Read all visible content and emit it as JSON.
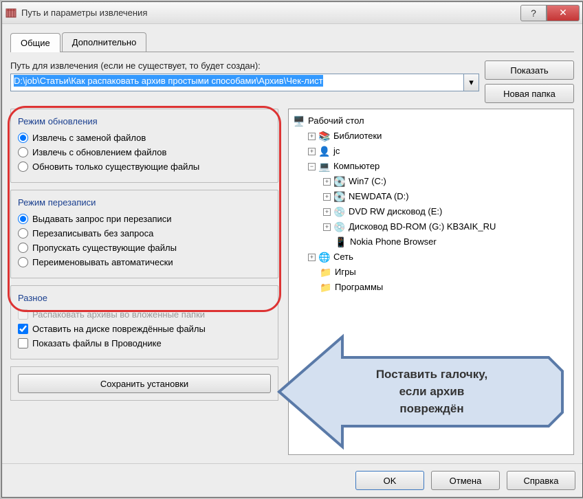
{
  "window": {
    "title": "Путь и параметры извлечения"
  },
  "tabs": {
    "general": "Общие",
    "advanced": "Дополнительно"
  },
  "path": {
    "label": "Путь для извлечения (если не существует, то будет создан):",
    "value": "D:\\job\\Статьи\\Как распаковать архив простыми способами\\Архив\\Чек-лист"
  },
  "buttons": {
    "show": "Показать",
    "new_folder": "Новая папка",
    "save": "Сохранить установки",
    "ok": "OK",
    "cancel": "Отмена",
    "help": "Справка"
  },
  "update_mode": {
    "legend": "Режим обновления",
    "opt1": "Извлечь с заменой файлов",
    "opt2": "Извлечь с обновлением файлов",
    "opt3": "Обновить только существующие файлы"
  },
  "overwrite_mode": {
    "legend": "Режим перезаписи",
    "opt1": "Выдавать запрос при перезаписи",
    "opt2": "Перезаписывать без запроса",
    "opt3": "Пропускать существующие файлы",
    "opt4": "Переименовывать автоматически"
  },
  "misc": {
    "legend": "Разное",
    "opt1": "Распаковать архивы во вложенные папки",
    "opt2": "Оставить на диске повреждённые файлы",
    "opt3": "Показать файлы в Проводнике"
  },
  "tree": {
    "desktop": "Рабочий стол",
    "libraries": "Библиотеки",
    "jc": "jc",
    "computer": "Компьютер",
    "win7": "Win7 (C:)",
    "newdata": "NEWDATA (D:)",
    "dvdrw": "DVD RW дисковод (E:)",
    "bdrom": "Дисковод BD-ROM (G:) KB3AIK_RU",
    "nokia": "Nokia Phone Browser",
    "network": "Сеть",
    "games": "Игры",
    "programs": "Программы"
  },
  "callout": {
    "line1": "Поставить галочку,",
    "line2": "если архив",
    "line3": "повреждён"
  }
}
